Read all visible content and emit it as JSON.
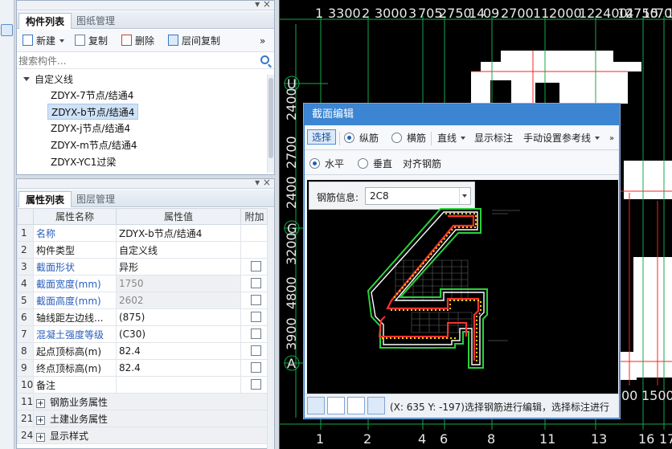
{
  "component_panel": {
    "tabs": [
      "构件列表",
      "图纸管理"
    ],
    "toolbar": {
      "new": "新建",
      "copy": "复制",
      "delete": "删除",
      "floor_copy": "层间复制",
      "more": "»"
    },
    "search_placeholder": "搜索构件...",
    "tree_root": "自定义线",
    "items": [
      "ZDYX-7节点/结通4",
      "ZDYX-b节点/结通4",
      "ZDYX-j节点/结通4",
      "ZDYX-m节点/结通4",
      "ZDYX-YC1过梁"
    ],
    "selected_index": 1
  },
  "property_panel": {
    "tabs": [
      "属性列表",
      "图层管理"
    ],
    "headers": [
      "属性名称",
      "属性值",
      "附加"
    ],
    "rows": [
      {
        "num": "1",
        "name": "名称",
        "value": "ZDYX-b节点/结通4",
        "link": true,
        "check": false,
        "grey": false
      },
      {
        "num": "2",
        "name": "构件类型",
        "value": "自定义线",
        "link": false,
        "check": false,
        "grey": false
      },
      {
        "num": "3",
        "name": "截面形状",
        "value": "异形",
        "link": true,
        "check": true,
        "grey": false
      },
      {
        "num": "4",
        "name": "截面宽度(mm)",
        "value": "1750",
        "link": true,
        "check": true,
        "grey": true
      },
      {
        "num": "5",
        "name": "截面高度(mm)",
        "value": "2602",
        "link": true,
        "check": true,
        "grey": true
      },
      {
        "num": "6",
        "name": "轴线距左边线...",
        "value": "(875)",
        "link": false,
        "check": true,
        "grey": false
      },
      {
        "num": "7",
        "name": "混凝土强度等级",
        "value": "(C30)",
        "link": true,
        "check": true,
        "grey": false
      },
      {
        "num": "8",
        "name": "起点顶标高(m)",
        "value": "82.4",
        "link": false,
        "check": true,
        "grey": false
      },
      {
        "num": "9",
        "name": "终点顶标高(m)",
        "value": "82.4",
        "link": false,
        "check": true,
        "grey": false
      },
      {
        "num": "10",
        "name": "备注",
        "value": "",
        "link": false,
        "check": true,
        "grey": false
      }
    ],
    "groups": [
      {
        "num": "11",
        "name": "钢筋业务属性"
      },
      {
        "num": "21",
        "name": "土建业务属性"
      },
      {
        "num": "24",
        "name": "显示样式"
      }
    ]
  },
  "cad": {
    "top_axis": [
      "1",
      "3300",
      "2",
      "3000",
      "3",
      "705",
      "2750",
      "14",
      "09",
      "2700",
      "11",
      "2000",
      "12",
      "2400",
      "14",
      "2750",
      "15",
      "700",
      "1"
    ],
    "bottom_axis": [
      "1",
      "2",
      "4",
      "6",
      "8",
      "11",
      "13",
      "16",
      "17"
    ],
    "left_axis": [
      "U",
      "G",
      "A"
    ],
    "left_dims": [
      "2400",
      "2700",
      "2400",
      "3200",
      "4800",
      "3900"
    ],
    "right_dims": [
      "00",
      "1500"
    ]
  },
  "dialog": {
    "title": "截面编辑",
    "toolbar": {
      "select": "选择",
      "longitudinal": "纵筋",
      "transverse": "横筋",
      "line_mode": "直线",
      "show_annotation": "显示标注",
      "manual_ref_line": "手动设置参考线",
      "more": "»"
    },
    "toolbar2": {
      "horizontal": "水平",
      "vertical": "垂直",
      "align_rebar": "对齐钢筋"
    },
    "rebar_info_label": "钢筋信息:",
    "rebar_info_value": "2C8",
    "status_text": "(X: 635 Y: -197)选择钢筋进行编辑，选择标注进行"
  }
}
